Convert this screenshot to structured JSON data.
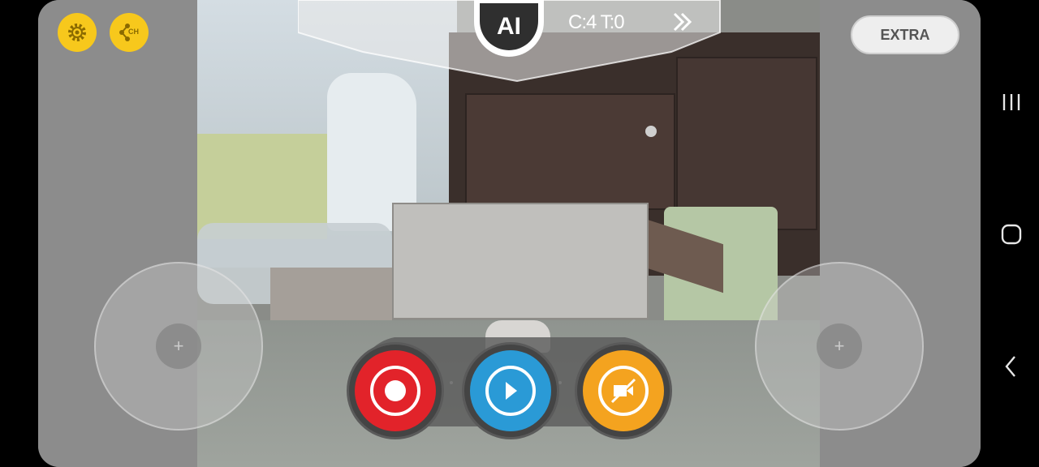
{
  "hud": {
    "ai_label": "AI",
    "counter": "C:4 T:0"
  },
  "extra_button": {
    "label": "EXTRA"
  },
  "icons": {
    "settings": "gear-icon",
    "channel": "channel-share-icon",
    "channel_label": "CH",
    "next": "double-chevron-right-icon",
    "record": "record-icon",
    "play": "play-icon",
    "video_off": "video-off-icon"
  },
  "colors": {
    "record": "#e2232a",
    "play": "#2a9ad6",
    "video": "#f4a31f",
    "accent_yellow": "#f7c81c"
  }
}
